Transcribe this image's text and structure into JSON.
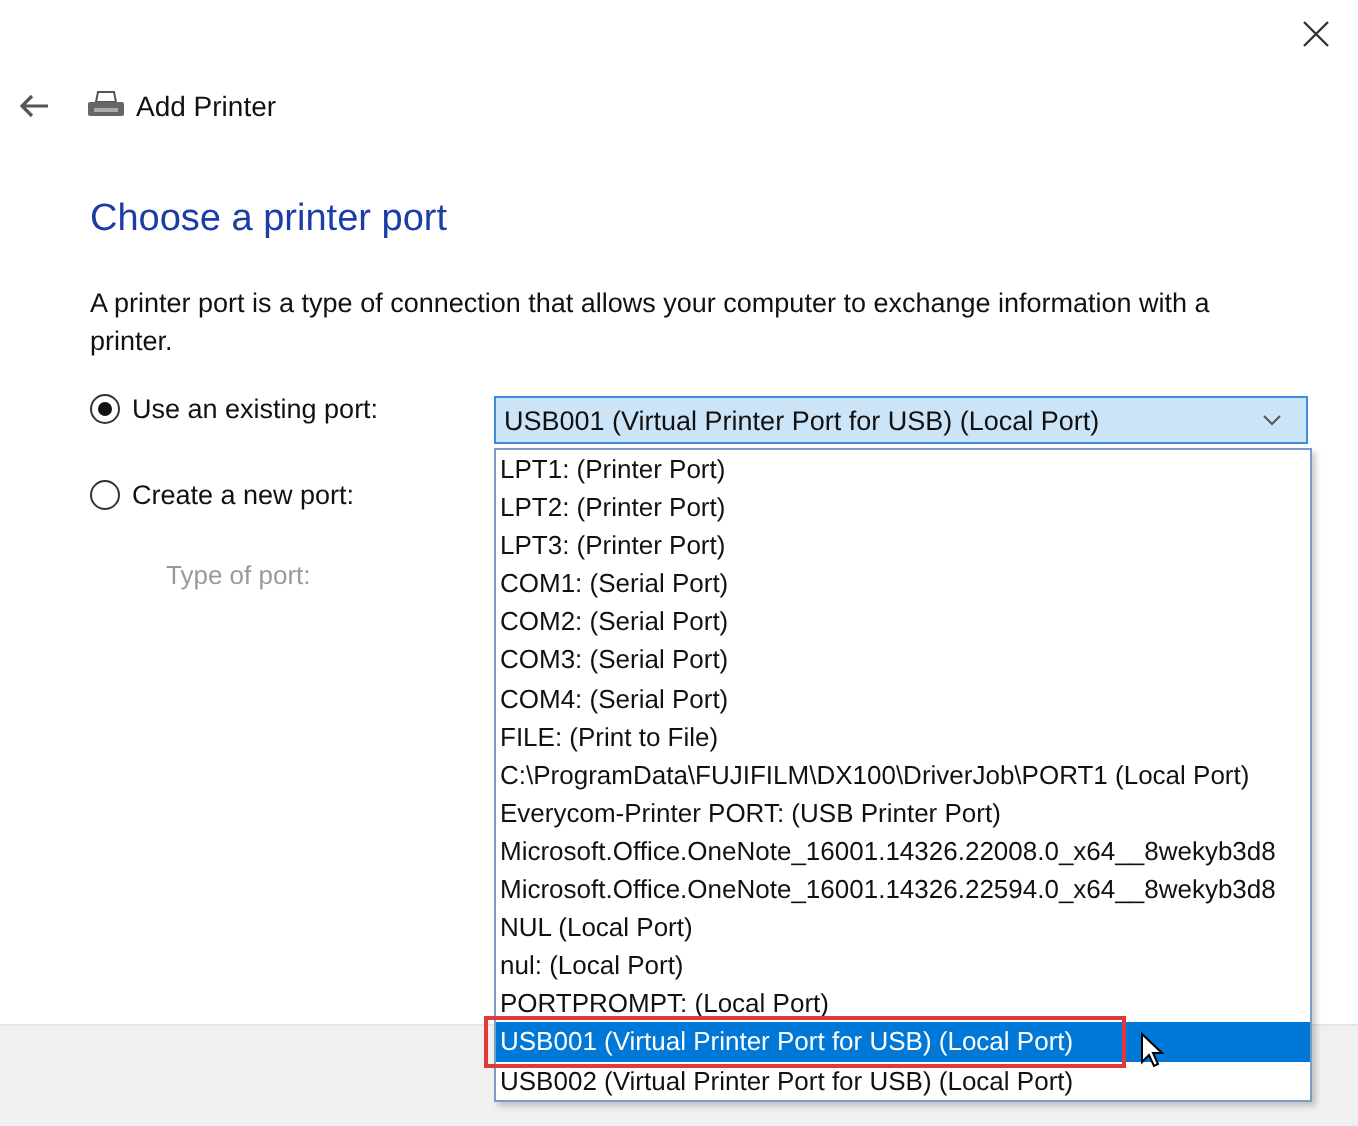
{
  "window": {
    "title": "Add Printer"
  },
  "heading": "Choose a printer port",
  "description": "A printer port is a type of connection that allows your computer to exchange information with a printer.",
  "options": [
    {
      "label": "Use an existing port:",
      "selected": true
    },
    {
      "label": "Create a new port:",
      "selected": false
    }
  ],
  "type_of_port": {
    "label": "Type of port:",
    "disabled": true
  },
  "port_combo": {
    "value": "USB001 (Virtual Printer Port for USB) (Local Port)",
    "expanded": true
  },
  "port_list": [
    {
      "label": "LPT1: (Printer Port)",
      "selected": false
    },
    {
      "label": "LPT2: (Printer Port)",
      "selected": false
    },
    {
      "label": "LPT3: (Printer Port)",
      "selected": false
    },
    {
      "label": "COM1: (Serial Port)",
      "selected": false
    },
    {
      "label": "COM2: (Serial Port)",
      "selected": false
    },
    {
      "label": "COM3: (Serial Port)",
      "selected": false
    },
    {
      "label": "COM4: (Serial Port)",
      "selected": false
    },
    {
      "label": "FILE: (Print to File)",
      "selected": false
    },
    {
      "label": "C:\\ProgramData\\FUJIFILM\\DX100\\DriverJob\\PORT1 (Local Port)",
      "selected": false
    },
    {
      "label": "Everycom-Printer PORT: (USB Printer Port)",
      "selected": false
    },
    {
      "label": "Microsoft.Office.OneNote_16001.14326.22008.0_x64__8wekyb3d8",
      "selected": false
    },
    {
      "label": "Microsoft.Office.OneNote_16001.14326.22594.0_x64__8wekyb3d8",
      "selected": false
    },
    {
      "label": "NUL (Local Port)",
      "selected": false
    },
    {
      "label": "nul: (Local Port)",
      "selected": false
    },
    {
      "label": "PORTPROMPT: (Local Port)",
      "selected": false
    },
    {
      "label": "USB001 (Virtual Printer Port for USB) (Local Port)",
      "selected": true,
      "highlighted": true
    },
    {
      "label": "USB002 (Virtual Printer Port for USB) (Local Port)",
      "selected": false
    }
  ]
}
